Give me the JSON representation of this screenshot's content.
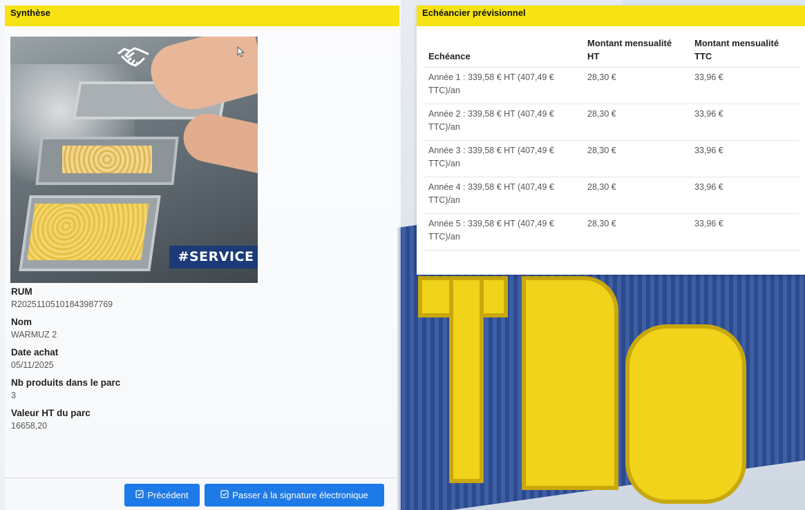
{
  "left_panel": {
    "title": "Synthèse",
    "image": {
      "tag_text": "#SERVICE"
    },
    "fields": [
      {
        "label": "RUM",
        "value": "R20251105101843987769"
      },
      {
        "label": "Nom",
        "value": "WARMUZ 2"
      },
      {
        "label": "Date achat",
        "value": "05/11/2025"
      },
      {
        "label": "Nb produits dans le parc",
        "value": "3"
      },
      {
        "label": "Valeur HT du parc",
        "value": "16658,20"
      }
    ],
    "buttons": {
      "previous": "Précédent",
      "next": "Passer à la signature électronique"
    }
  },
  "right_panel": {
    "title": "Echéancier prévisionnel",
    "columns": [
      "Echéance",
      "Montant mensualité HT",
      "Montant mensualité TTC"
    ],
    "rows": [
      [
        "Année 1 : 339,58 € HT (407,49 € TTC)/an",
        "28,30 €",
        "33,96 €"
      ],
      [
        "Année 2 : 339,58 € HT (407,49 € TTC)/an",
        "28,30 €",
        "33,96 €"
      ],
      [
        "Année 3 : 339,58 € HT (407,49 € TTC)/an",
        "28,30 €",
        "33,96 €"
      ],
      [
        "Année 4 : 339,58 € HT (407,49 € TTC)/an",
        "28,30 €",
        "33,96 €"
      ],
      [
        "Année 5 : 339,58 € HT (407,49 € TTC)/an",
        "28,30 €",
        "33,96 €"
      ]
    ]
  },
  "colors": {
    "header_yellow": "#f7e313",
    "button_blue": "#1e7ae6",
    "tag_blue": "#1b3a77"
  },
  "icons": {
    "button_icon": "check-square-icon",
    "image_icon": "handshake-icon"
  }
}
